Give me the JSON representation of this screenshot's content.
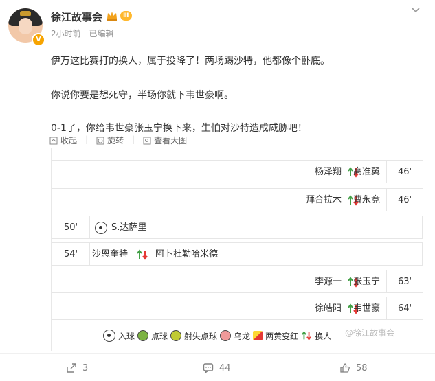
{
  "author": {
    "name": "徐江故事会",
    "level_badge": "Ⅲ",
    "vip_badge": "V"
  },
  "meta": {
    "time": "2小时前",
    "edited": "已编辑"
  },
  "post": {
    "p1": "伊万这比赛打的换人，属于投降了！两场踢沙特，他都像个卧底。",
    "p2": "你说你要是想死守，半场你就下韦世豪啊。",
    "p3": "0-1了，你给韦世豪张玉宁换下来，生怕对沙特造成威胁吧！"
  },
  "image_toolbar": {
    "collapse": "收起",
    "rotate": "旋转",
    "view_large": "查看大图"
  },
  "events": [
    {
      "side": "right",
      "minute": "46'",
      "in": "杨泽翔",
      "out": "高准翼",
      "type": "sub"
    },
    {
      "side": "right",
      "minute": "46'",
      "in": "拜合拉木",
      "out": "曹永竞",
      "type": "sub"
    },
    {
      "side": "left",
      "minute": "50'",
      "player": "S.达萨里",
      "type": "goal"
    },
    {
      "side": "left",
      "minute": "54'",
      "in": "沙恩奎特",
      "out": "阿卜杜勒哈米德",
      "type": "sub"
    },
    {
      "side": "right",
      "minute": "63'",
      "in": "李源一",
      "out": "张玉宁",
      "type": "sub"
    },
    {
      "side": "right",
      "minute": "64'",
      "in": "徐皓阳",
      "out": "韦世豪",
      "type": "sub"
    }
  ],
  "legend": {
    "goal": "入球",
    "penalty": "点球",
    "missed_penalty": "射失点球",
    "own_goal": "乌龙",
    "two_yellow": "两黄变红",
    "sub": "换人"
  },
  "watermark": "@徐江故事会",
  "footer": {
    "shares": "3",
    "comments": "44",
    "likes": "58"
  },
  "colors": {
    "accent": "#ff8200",
    "sub_up": "#43a047",
    "sub_down": "#e53935",
    "vip": "#f7a400"
  }
}
